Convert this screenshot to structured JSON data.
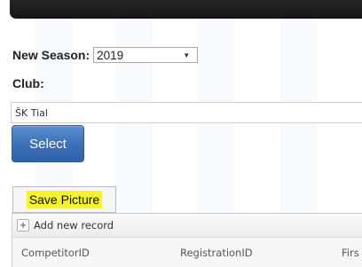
{
  "form": {
    "season_label": "New Season:",
    "season_value": "2019",
    "club_label": "Club:",
    "club_value": "ŠK Tial",
    "select_button": "Select",
    "save_picture_button": "Save Picture"
  },
  "grid": {
    "add_record_label": "Add new record",
    "columns": [
      "CompetitorID",
      "RegistrationID",
      "Firs"
    ]
  },
  "colors": {
    "select_button_bg": "#3a6fb6",
    "highlight": "#f5f232"
  }
}
